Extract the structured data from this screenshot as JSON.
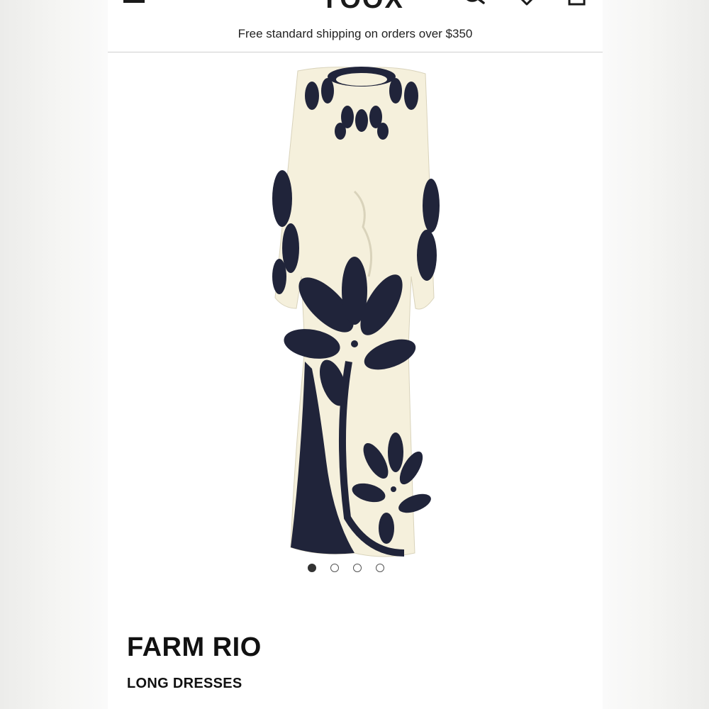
{
  "header": {
    "logo": "YOOX",
    "shipping_banner": "Free standard shipping on orders over $350"
  },
  "icons": [
    "menu-icon",
    "search-icon",
    "heart-icon",
    "bag-icon"
  ],
  "gallery": {
    "image_alt": "Cream and navy floral print long dress with balloon sleeves",
    "dot_count": 4,
    "active_index": 0,
    "colors": {
      "cream": "#f5f0dc",
      "navy": "#20243a"
    }
  },
  "product": {
    "brand": "FARM RIO",
    "category": "LONG DRESSES"
  }
}
